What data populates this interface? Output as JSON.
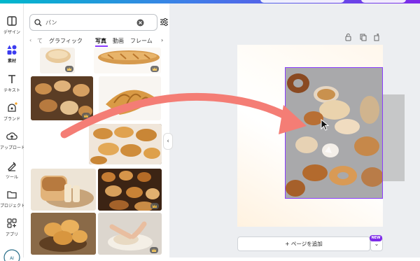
{
  "rail": {
    "items": [
      {
        "label": "デザイン",
        "icon": "layout-icon"
      },
      {
        "label": "素材",
        "icon": "elements-icon"
      },
      {
        "label": "テキスト",
        "icon": "text-icon"
      },
      {
        "label": "ブランド",
        "icon": "brand-icon"
      },
      {
        "label": "アップロード",
        "icon": "upload-icon"
      },
      {
        "label": "ツール",
        "icon": "tools-icon"
      },
      {
        "label": "プロジェクト",
        "icon": "folder-icon"
      },
      {
        "label": "アプリ",
        "icon": "apps-icon"
      }
    ]
  },
  "search": {
    "value": "パン"
  },
  "tabs": {
    "items": [
      "グラフィック",
      "写真",
      "動画",
      "フレーム"
    ],
    "active": "写真"
  },
  "canvas": {
    "add_page_label": "+ ページを追加",
    "new_badge": "NEW"
  },
  "colors": {
    "accent": "#8b3dff",
    "arrow": "#f47d75",
    "canvas_bg": "#eceef1"
  }
}
